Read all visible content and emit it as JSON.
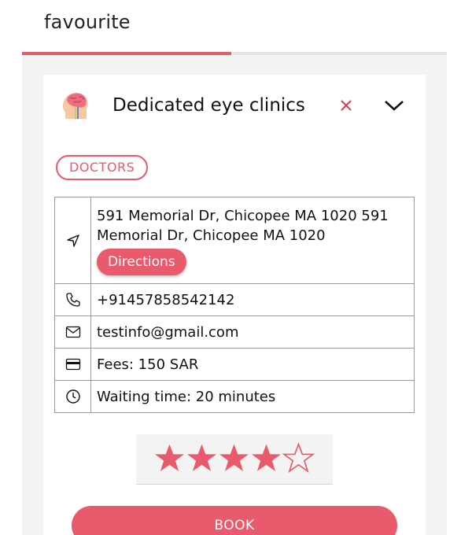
{
  "header": {
    "title": "favourite"
  },
  "card": {
    "title": "Dedicated eye clinics",
    "avatar_icon": "brain-head-icon",
    "tag": "DOCTORS",
    "address": "591 Memorial Dr, Chicopee MA 1020 591 Memorial Dr, Chicopee MA 1020",
    "directions_label": "Directions",
    "phone": "+91457858542142",
    "email": "testinfo@gmail.com",
    "fees": "Fees: 150 SAR",
    "waiting_time": "Waiting time: 20 minutes",
    "rating": {
      "value": 4,
      "max": 5
    },
    "book_label": "BOOK"
  },
  "colors": {
    "accent": "#e85a6c",
    "remove": "#e5394f"
  }
}
